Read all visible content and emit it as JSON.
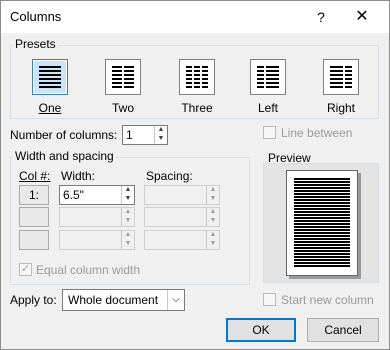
{
  "window": {
    "title": "Columns",
    "help_label": "?",
    "close_label": "✕"
  },
  "presets": {
    "label": "Presets",
    "items": [
      {
        "label": "One",
        "selected": true
      },
      {
        "label": "Two",
        "selected": false
      },
      {
        "label": "Three",
        "selected": false
      },
      {
        "label": "Left",
        "selected": false
      },
      {
        "label": "Right",
        "selected": false
      }
    ]
  },
  "number_of_columns": {
    "label": "Number of columns:",
    "value": "1"
  },
  "line_between": {
    "label": "Line between",
    "checked": false
  },
  "width_spacing": {
    "label": "Width and spacing",
    "col_header": "Col #:",
    "width_header": "Width:",
    "spacing_header": "Spacing:",
    "rows": [
      {
        "col": "1:",
        "width": "6.5\"",
        "spacing": ""
      },
      {
        "col": "",
        "width": "",
        "spacing": ""
      },
      {
        "col": "",
        "width": "",
        "spacing": ""
      }
    ]
  },
  "equal_width": {
    "label": "Equal column width",
    "checked": true
  },
  "preview": {
    "label": "Preview"
  },
  "apply_to": {
    "label": "Apply to:",
    "value": "Whole document"
  },
  "start_new_column": {
    "label": "Start new column",
    "checked": false
  },
  "buttons": {
    "ok": "OK",
    "cancel": "Cancel"
  },
  "colors": {
    "accent": "#0078d7",
    "selected_bg": "#cce4f7"
  }
}
